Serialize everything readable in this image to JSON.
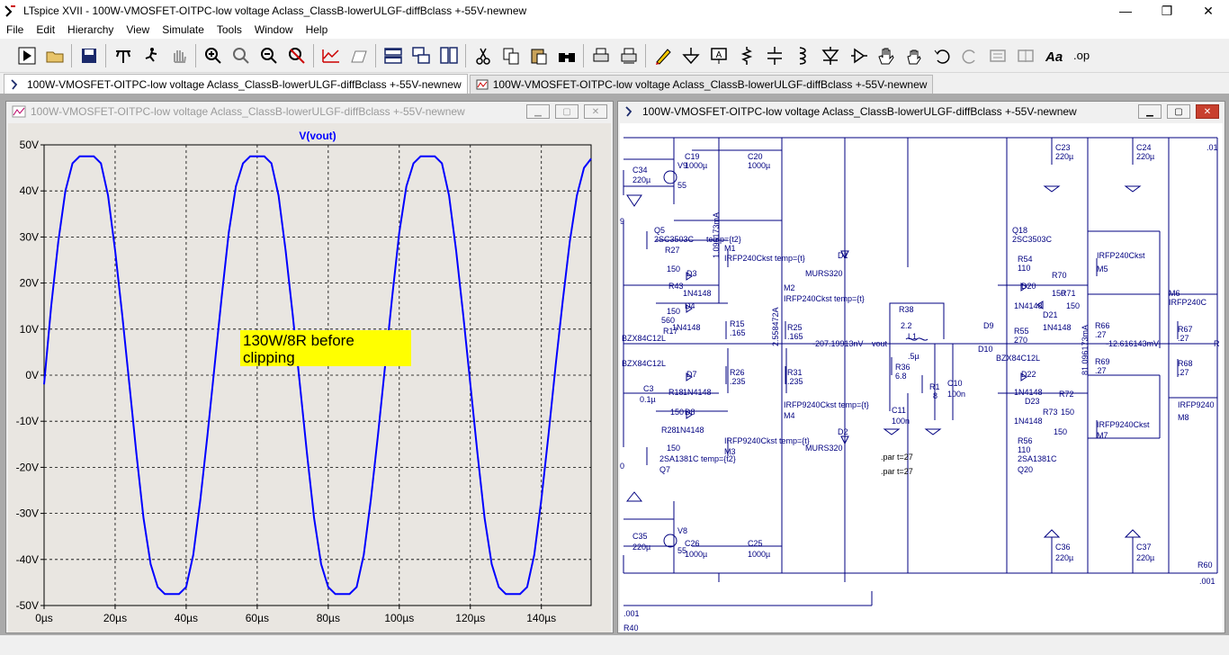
{
  "window": {
    "title": "LTspice XVII - 100W-VMOSFET-OITPC-low voltage Aclass_ClassB-lowerULGF-diffBclass +-55V-newnew",
    "controls": {
      "minimize": "—",
      "maximize": "❐",
      "close": "✕"
    }
  },
  "menu": [
    "File",
    "Edit",
    "Hierarchy",
    "View",
    "Simulate",
    "Tools",
    "Window",
    "Help"
  ],
  "toolbar": {
    "icons": [
      "run-icon",
      "open-icon",
      "save-icon",
      "control-panel-icon",
      "run-simulation-icon",
      "halt-icon",
      "zoom-in-icon",
      "zoom-pan-icon",
      "zoom-out-icon",
      "zoom-fit-icon",
      "autorange-icon",
      "waveform-icon",
      "tile-horizontal-icon",
      "cascade-icon",
      "tile-vertical-icon",
      "cut-icon",
      "copy-icon",
      "paste-icon",
      "find-icon",
      "print-icon",
      "print-setup-icon",
      "wire-pencil-icon",
      "ground-icon",
      "label-icon",
      "resistor-icon",
      "capacitor-icon",
      "inductor-icon",
      "diode-icon",
      "component-icon",
      "move-hand-icon",
      "drag-hand-icon",
      "undo-icon",
      "redo-icon",
      "rotate-icon",
      "mirror-icon",
      "text-icon",
      "spice-directive-icon"
    ]
  },
  "tabs": [
    {
      "label": "100W-VMOSFET-OITPC-low voltage Aclass_ClassB-lowerULGF-diffBclass +-55V-newnew",
      "icon": "schematic-icon",
      "active": true
    },
    {
      "label": "100W-VMOSFET-OITPC-low voltage Aclass_ClassB-lowerULGF-diffBclass +-55V-newnew",
      "icon": "waveform-icon",
      "active": false
    }
  ],
  "waveform_window": {
    "title": "100W-VMOSFET-OITPC-low voltage Aclass_ClassB-lowerULGF-diffBclass +-55V-newnew",
    "annotation": [
      "130W/8R before",
      "clipping"
    ],
    "annotation_color": "#ffff00",
    "trace_color": "#0000ff"
  },
  "schematic_window": {
    "title": "100W-VMOSFET-OITPC-low voltage Aclass_ClassB-lowerULGF-diffBclass +-55V-newnew",
    "labels": {
      "c19": "C19",
      "c19v": "1000µ",
      "c20": "C20",
      "c20v": "1000µ",
      "c23": "C23",
      "c23v": "220µ",
      "c24": "C24",
      "c24v": "220µ",
      "c34": "C34",
      "c34v": "220µ",
      "v9": "V9",
      "v9v": "55",
      "m_ia": "1.096173mA",
      "c01": ".01",
      "q5": "Q5",
      "q5m": "2SC3503C",
      "q5t": "temp={t2}",
      "r27": "R27",
      "r27v": "150",
      "m1": "M1",
      "m1m": "IRFP240Ckst temp={t}",
      "d1": "D1",
      "d1m": "MURS320",
      "q18": "Q18",
      "q18m": "2SC3503C",
      "r54": "R54",
      "r54v": "110",
      "m5m": "IRFP240Ckst",
      "m5": "M5",
      "d3": "D3",
      "r43": "R43",
      "d4148a": "1N4148",
      "r70": "R70",
      "r70v": "150",
      "d20": "D20",
      "r71": "R71",
      "r71v": "150",
      "d4148b": "1N4148",
      "m6": "M6",
      "m6m": "IRFP240C",
      "m2": "M2",
      "m2m": "IRFP240Ckst temp={t}",
      "r42v": "150",
      "d4": "D4",
      "d4148c": "1N4148",
      "r15": "R15",
      "r15v": ".165",
      "d21": "D21",
      "d4148d": "1N4148",
      "r66": "R66",
      "r66v": ".27",
      "r67": "R67",
      "r67v": ".27",
      "d22m": "2.558472A",
      "r17v": "560",
      "r17": "R17",
      "r25": "R25",
      "r25v": ".165",
      "r38": "R38",
      "r38v": "2.2",
      "d9": "D9",
      "r55": "R55",
      "r55v": "270",
      "bzx1": "BZX84C12L",
      "vout_v": "-207.19913nV",
      "vout": "vout",
      "l1": "L1",
      "l1v": ".5µ",
      "d10": "D10",
      "bzx2": "BZX84C12L",
      "neg_v": "-12.616143mV",
      "ia2": "81.096173mA",
      "bzx3": "BZX84C12L",
      "r26": "R26",
      "r26v": ".235",
      "r31": "R31",
      "r31v": ".235",
      "r36": "R36",
      "r36v": "6.8",
      "r1": "R1",
      "r1v": "8",
      "c10": "C10",
      "c10v": "100n",
      "r69": "R69",
      "r69v": ".27",
      "r68": "R68",
      "r68v": ".27",
      "d7": "D7",
      "c3": "C3",
      "c3v": "0.1µ",
      "r18": "R18",
      "d4148e": "1N4148",
      "r18v": "150",
      "d8": "D8",
      "m4m": "IRFP9240Ckst temp={t}",
      "m4": "M4",
      "c11": "C11",
      "c11v": "100n",
      "d22": "D22",
      "d4148f": "1N4148",
      "d23": "D23",
      "r72": "R72",
      "r73": "R73",
      "r73v": "150",
      "m8m": "IRFP9240",
      "m8": "M8",
      "r28": "R28",
      "d4148g": "1N4148",
      "d2": "D2",
      "d2m": "MURS320",
      "d4148h": "1N4148",
      "r150": "150",
      "m7m": "IRFP9240Ckst",
      "m7": "M7",
      "r28v": "150",
      "m3m": "IRFP9240Ckst temp={t}",
      "q7m": "2SA1381C temp={t2}",
      "m3": "M3",
      "q7": "Q7",
      "r56": "R56",
      "r56v": "110",
      "par1": ".par t=27",
      "par2": ".par t=27",
      "q20m": "2SA1381C",
      "q20": "Q20",
      "v8": "V8",
      "c35": "C35",
      "c35v": "220µ",
      "c26": "C26",
      "c26v": "1000µ",
      "c25": "C25",
      "c25v": "1000µ",
      "c36": "C36",
      "c36v": "220µ",
      "c37": "C37",
      "c37v": "220µ",
      "r60": "R60",
      "r60v": ".001",
      "r40v": ".001",
      "r40": "R40",
      "n9": "9",
      "n0": "0",
      "nR": "R",
      "n55": "55"
    }
  },
  "chart_data": {
    "type": "line",
    "title": "V(vout)",
    "xlabel": "",
    "ylabel": "",
    "x_unit": "µs",
    "y_unit": "V",
    "xlim": [
      0,
      154
    ],
    "ylim": [
      -50,
      50
    ],
    "x_ticks": [
      "0µs",
      "20µs",
      "40µs",
      "60µs",
      "80µs",
      "100µs",
      "120µs",
      "140µs"
    ],
    "y_ticks": [
      "50V",
      "40V",
      "30V",
      "20V",
      "10V",
      "0V",
      "-10V",
      "-20V",
      "-30V",
      "-40V",
      "-50V"
    ],
    "grid": true,
    "series": [
      {
        "name": "V(vout)",
        "x": [
          0,
          2,
          4,
          6,
          8,
          10,
          12,
          14,
          16,
          18,
          20,
          22,
          24,
          26,
          28,
          30,
          32,
          34,
          36,
          38,
          40,
          42,
          44,
          46,
          48,
          50,
          52,
          54,
          56,
          58,
          60,
          62,
          64,
          66,
          68,
          70,
          72,
          74,
          76,
          78,
          80,
          82,
          84,
          86,
          88,
          90,
          92,
          94,
          96,
          98,
          100,
          102,
          104,
          106,
          108,
          110,
          112,
          114,
          116,
          118,
          120,
          122,
          124,
          126,
          128,
          130,
          132,
          134,
          136,
          138,
          140,
          142,
          144,
          146,
          148,
          150,
          152,
          154
        ],
        "values": [
          -2,
          15,
          29,
          40,
          46,
          47.5,
          47.5,
          47.5,
          46,
          39,
          27,
          13,
          -2,
          -17,
          -31,
          -41,
          -46,
          -47.5,
          -47.5,
          -47.5,
          -46,
          -39,
          -27,
          -13,
          2,
          17,
          31,
          41,
          46,
          47.5,
          47.5,
          47.5,
          46,
          39,
          27,
          13,
          -2,
          -17,
          -31,
          -41,
          -46,
          -47.5,
          -47.5,
          -47.5,
          -46,
          -39,
          -27,
          -13,
          2,
          17,
          31,
          41,
          46,
          47.5,
          47.5,
          47.5,
          46,
          39,
          27,
          13,
          -2,
          -17,
          -31,
          -41,
          -46,
          -47.5,
          -47.5,
          -47.5,
          -46,
          -39,
          -27,
          -13,
          2,
          16,
          29,
          39,
          45,
          47
        ]
      }
    ]
  }
}
